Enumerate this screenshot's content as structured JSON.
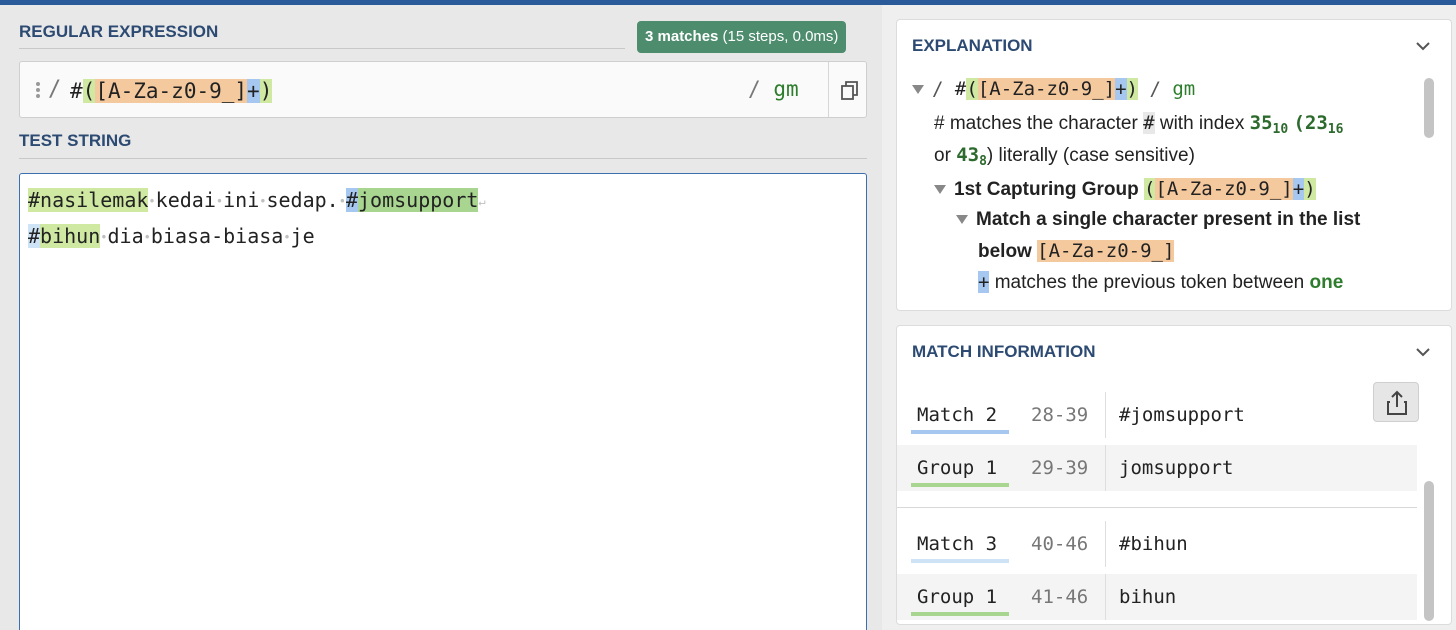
{
  "regex": {
    "title": "REGULAR EXPRESSION",
    "match_count": "3 matches",
    "match_stats": "(15 steps, 0.0ms)",
    "delimiter": "/",
    "pattern_tokens": [
      "#",
      "(",
      "[A-Za-z0-9_]",
      "+",
      ")"
    ],
    "flags": "gm"
  },
  "test_string": {
    "title": "TEST STRING",
    "line1": {
      "m1_hash": "#",
      "m1_word": "nasilemak",
      "t1": "kedai",
      "t2": "ini",
      "t3": "sedap.",
      "m2_hash": "#",
      "m2_word": "jomsupport"
    },
    "line2": {
      "m3_hash": "#",
      "m3_word": "bihun",
      "t1": "dia",
      "t2": "biasa-biasa",
      "t3": "je"
    }
  },
  "explanation": {
    "title": "EXPLANATION",
    "line1_pattern": "#([A-Za-z0-9_]+)",
    "line2": {
      "hash": "#",
      "pre": "# matches the character",
      "mid": "with index",
      "n1": "35",
      "b1": "10",
      "n2": "23",
      "b2": "16"
    },
    "line3": {
      "pre": "or",
      "n3": "43",
      "b3": "8",
      "post": ") literally (case sensitive)"
    },
    "group_label": "1st Capturing Group",
    "group_pattern": "([A-Za-z0-9_]+)",
    "match_single_1": "Match a single character present in the list",
    "match_single_2": "below",
    "class_pattern": "[A-Za-z0-9_]",
    "quant_token": "+",
    "quant_desc": "matches the previous token between",
    "quant_word": "one"
  },
  "match_info": {
    "title": "MATCH INFORMATION",
    "rows": [
      {
        "label": "Match 2",
        "range": "28-39",
        "value": "#jomsupport"
      },
      {
        "label": "Group 1",
        "range": "29-39",
        "value": "jomsupport"
      },
      {
        "label": "Match 3",
        "range": "40-46",
        "value": "#bihun"
      },
      {
        "label": "Group 1",
        "range": "41-46",
        "value": "bihun"
      }
    ]
  },
  "colors": {
    "group_green": "#cfe9a3",
    "class_orange": "#f5c99e",
    "quant_blue": "#a6c8f0",
    "badge_green": "#4d8c6d",
    "title_blue": "#2c4a72"
  }
}
